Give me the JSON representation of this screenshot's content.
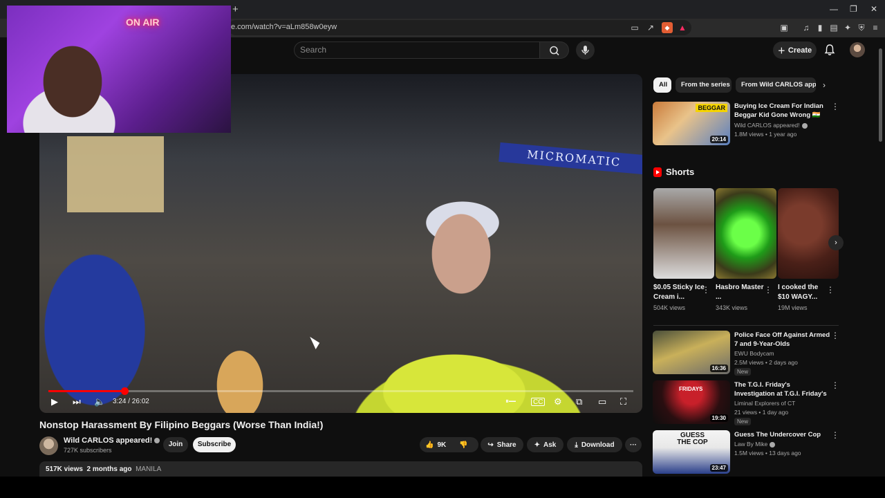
{
  "browser": {
    "url": "e.com/watch?v=aLm858w0eyw",
    "new_tab_label": "+",
    "window_controls": [
      "—",
      "❐",
      "✕"
    ]
  },
  "header": {
    "search_placeholder": "Search",
    "create_label": "Create"
  },
  "webcam": {
    "sign": "ON AIR"
  },
  "player": {
    "scene_sign": "MICROMATIC",
    "time": "3:24 / 26:02",
    "progress": 0.13
  },
  "video": {
    "title": "Nonstop Harassment By Filipino Beggars (Worse Than India!)",
    "channel": "Wild CARLOS appeared!",
    "subscribers": "727K subscribers",
    "join_label": "Join",
    "subscribe_label": "Subscribe",
    "likes": "9K",
    "share_label": "Share",
    "ask_label": "Ask",
    "download_label": "Download",
    "views": "517K views",
    "age": "2 months ago",
    "tag": "MANILA"
  },
  "sidebar": {
    "chips": [
      "All",
      "From the series",
      "From Wild CARLOS appe"
    ],
    "videos": [
      {
        "title": "Buying Ice Cream For Indian Beggar Kid Gone Wrong 🇮🇳",
        "channel": "Wild CARLOS appeared!",
        "meta": "1.8M views • 1 year ago",
        "duration": "20:14",
        "thumb_text": "BEGGAR",
        "new": ""
      },
      {
        "title": "Police Face Off Against Armed 7 and 9-Year-Olds",
        "channel": "EWU Bodycam",
        "meta": "2.5M views • 2 days ago",
        "duration": "16:36",
        "thumb_text": "",
        "new": "New"
      },
      {
        "title": "The T.G.I. Friday's Investigation at T.G.I. Friday's",
        "channel": "Liminal Explorers of CT",
        "meta": "21 views • 1 day ago",
        "duration": "19:30",
        "thumb_text": "FRIDAYS",
        "new": "New"
      },
      {
        "title": "Guess The Undercover Cop",
        "channel": "Law By Mike",
        "meta": "1.5M views • 13 days ago",
        "duration": "23:47",
        "thumb_text": "GUESS THE COP",
        "new": ""
      }
    ],
    "shorts_heading": "Shorts",
    "shorts": [
      {
        "title": "$0.05 Sticky Ice Cream i...",
        "views": "504K views"
      },
      {
        "title": "Hasbro Master ...",
        "views": "343K views"
      },
      {
        "title": "I cooked the $10 WAGY...",
        "views": "19M views"
      }
    ]
  },
  "colors": {
    "accent": "#ff0000",
    "bg": "#0f0f0f",
    "pill": "#272727"
  }
}
